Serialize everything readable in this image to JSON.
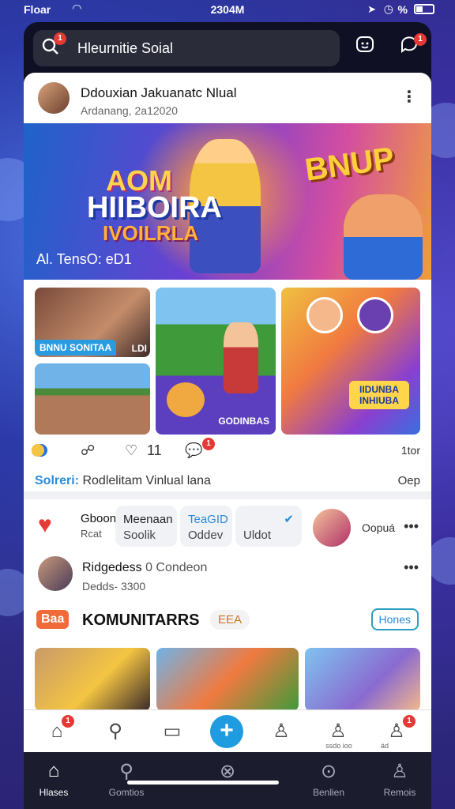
{
  "status": {
    "left": "Floar",
    "time": "2304M",
    "right": "%"
  },
  "search": {
    "placeholder": "Hleurnitie Soial",
    "badge": "1",
    "msg_badge": "1"
  },
  "post": {
    "name": "Ddouxian Jakuanatc Nlual",
    "date": "Ardanang, 2a12020",
    "hero": {
      "line1": "AOM",
      "line2": "HIIBOIRA",
      "line3": "IVOILRLA",
      "right": "BNUP",
      "caption": "Al. TensO: eD1"
    },
    "tiles": {
      "t1_label": "BNNU SONITAA",
      "t1_tag": "LDI",
      "t2_label": "GODINBAS",
      "t3_label": "IIDUNBA INHIUBA"
    },
    "actions": {
      "reactions_count": "",
      "likes": "11",
      "comment_badge": "1",
      "right": "1tor"
    },
    "sub_label": "Solreri:",
    "sub_text": "Rodlelitam Vinlual lana",
    "sub_right": "Oep"
  },
  "row1": {
    "label1": "Gboon",
    "label1b": "Rcat",
    "pill1a": "Meenaan",
    "pill1b": "Soolik",
    "pill2a": "TeaGID",
    "pill2b": "Oddev",
    "pill3a": "",
    "pill3b": "Uldot",
    "right": "Oopuá"
  },
  "row2": {
    "name": "Ridgedess",
    "name_extra": "0 Condeon",
    "sub": "Dedds- 3300"
  },
  "row3": {
    "tag": "Baa",
    "title": "KOMUNITARRS",
    "chip": "EEA",
    "link": "Hones"
  },
  "tabbar": {
    "lbl5": "ssdo ioo",
    "lbl6": "ád",
    "home_badge": "1",
    "last_badge": "1"
  },
  "navbar": {
    "n1": "Hlases",
    "n2": "Gomtios",
    "n4": "Benlien",
    "n5": "Remois"
  }
}
